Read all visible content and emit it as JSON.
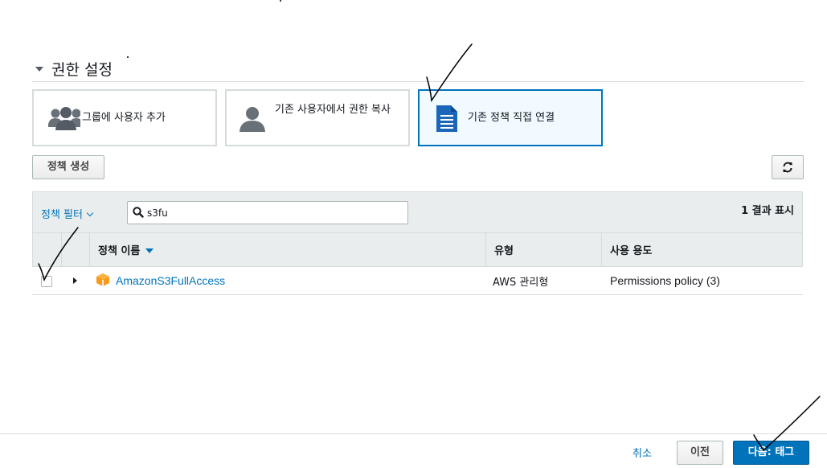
{
  "section": {
    "title": "권한 설정",
    "expanded": true
  },
  "options": [
    {
      "icon": "group-icon",
      "label": "그룹에 사용자 추가",
      "selected": false
    },
    {
      "icon": "user-icon",
      "label": "기존 사용자에서 권한 복사",
      "selected": false
    },
    {
      "icon": "document-icon",
      "label": "기존 정책 직접 연결",
      "selected": true
    }
  ],
  "toolbar": {
    "create_policy_label": "정책 생성",
    "refresh_icon": "refresh-icon"
  },
  "filter": {
    "label": "정책 필터",
    "search_value": "s3fu",
    "result_count": "1 결과 표시"
  },
  "table": {
    "columns": {
      "name": "정책 이름",
      "type": "유형",
      "usage": "사용 용도"
    },
    "sort_column": "name",
    "rows": [
      {
        "checked": false,
        "name": "AmazonS3FullAccess",
        "type": "AWS 관리형",
        "usage": "Permissions policy (3)"
      }
    ]
  },
  "footer": {
    "cancel_label": "취소",
    "previous_label": "이전",
    "next_label": "다음: 태그"
  },
  "colors": {
    "accent": "#0073bb",
    "selected_bg": "#f1faff",
    "header_bg": "#eaeded",
    "border": "#d5dbdb"
  }
}
